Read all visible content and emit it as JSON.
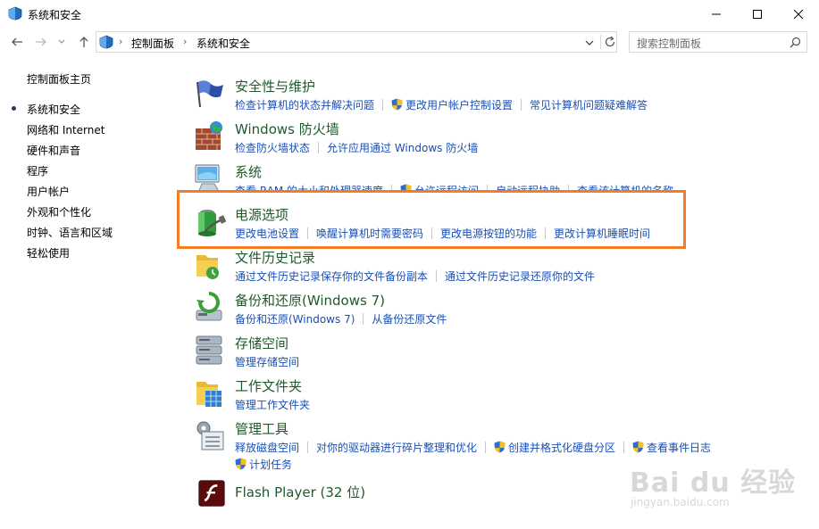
{
  "window": {
    "title": "系统和安全",
    "minimize_icon": "minimize-icon",
    "maximize_icon": "maximize-icon",
    "close_icon": "close-icon"
  },
  "address_bar": {
    "crumbs": [
      "控制面板",
      "系统和安全"
    ],
    "dropdown_icon": "chevron-down-icon",
    "refresh_icon": "refresh-icon"
  },
  "search": {
    "placeholder": "搜索控制面板"
  },
  "left_nav": {
    "items": [
      {
        "label": "控制面板主页",
        "current": false
      },
      {
        "label": "系统和安全",
        "current": true
      },
      {
        "label": "网络和 Internet",
        "current": false
      },
      {
        "label": "硬件和声音",
        "current": false
      },
      {
        "label": "程序",
        "current": false
      },
      {
        "label": "用户帐户",
        "current": false
      },
      {
        "label": "外观和个性化",
        "current": false
      },
      {
        "label": "时钟、语言和区域",
        "current": false
      },
      {
        "label": "轻松使用",
        "current": false
      }
    ]
  },
  "categories": [
    {
      "title": "安全性与维护",
      "links": [
        "检查计算机的状态并解决问题",
        "更改用户帐户控制设置",
        "常见计算机问题疑难解答"
      ],
      "icon": "flag-icon"
    },
    {
      "title": "Windows 防火墙",
      "links": [
        "检查防火墙状态",
        "允许应用通过 Windows 防火墙"
      ],
      "icon": "firewall-icon"
    },
    {
      "title": "系统",
      "links": [
        "查看 RAM 的大小和处理器速度",
        "允许远程访问",
        "启动远程协助",
        "查看该计算机的名称"
      ],
      "icon": "computer-icon"
    },
    {
      "title": "电源选项",
      "links": [
        "更改电池设置",
        "唤醒计算机时需要密码",
        "更改电源按钮的功能",
        "更改计算机睡眠时间"
      ],
      "icon": "battery-icon"
    },
    {
      "title": "文件历史记录",
      "links": [
        "通过文件历史记录保存你的文件备份副本",
        "通过文件历史记录还原你的文件"
      ],
      "icon": "file-history-icon"
    },
    {
      "title": "备份和还原(Windows 7)",
      "links": [
        "备份和还原(Windows 7)",
        "从备份还原文件"
      ],
      "icon": "backup-icon"
    },
    {
      "title": "存储空间",
      "links": [
        "管理存储空间"
      ],
      "icon": "storage-icon"
    },
    {
      "title": "工作文件夹",
      "links": [
        "管理工作文件夹"
      ],
      "icon": "work-folders-icon"
    },
    {
      "title": "管理工具",
      "links": [
        "释放磁盘空间",
        "对你的驱动器进行碎片整理和优化",
        "创建并格式化硬盘分区",
        "查看事件日志",
        "计划任务"
      ],
      "icon": "admin-tools-icon"
    },
    {
      "title": "Flash Player (32 位)",
      "links": [],
      "icon": "flash-icon"
    }
  ],
  "watermark": {
    "text": "Bai du 经验",
    "sub": "jingyan.baidu.com"
  },
  "colors": {
    "highlight": "#f27d26",
    "link": "#1a4fb3",
    "title_green": "#1e5a2a"
  }
}
